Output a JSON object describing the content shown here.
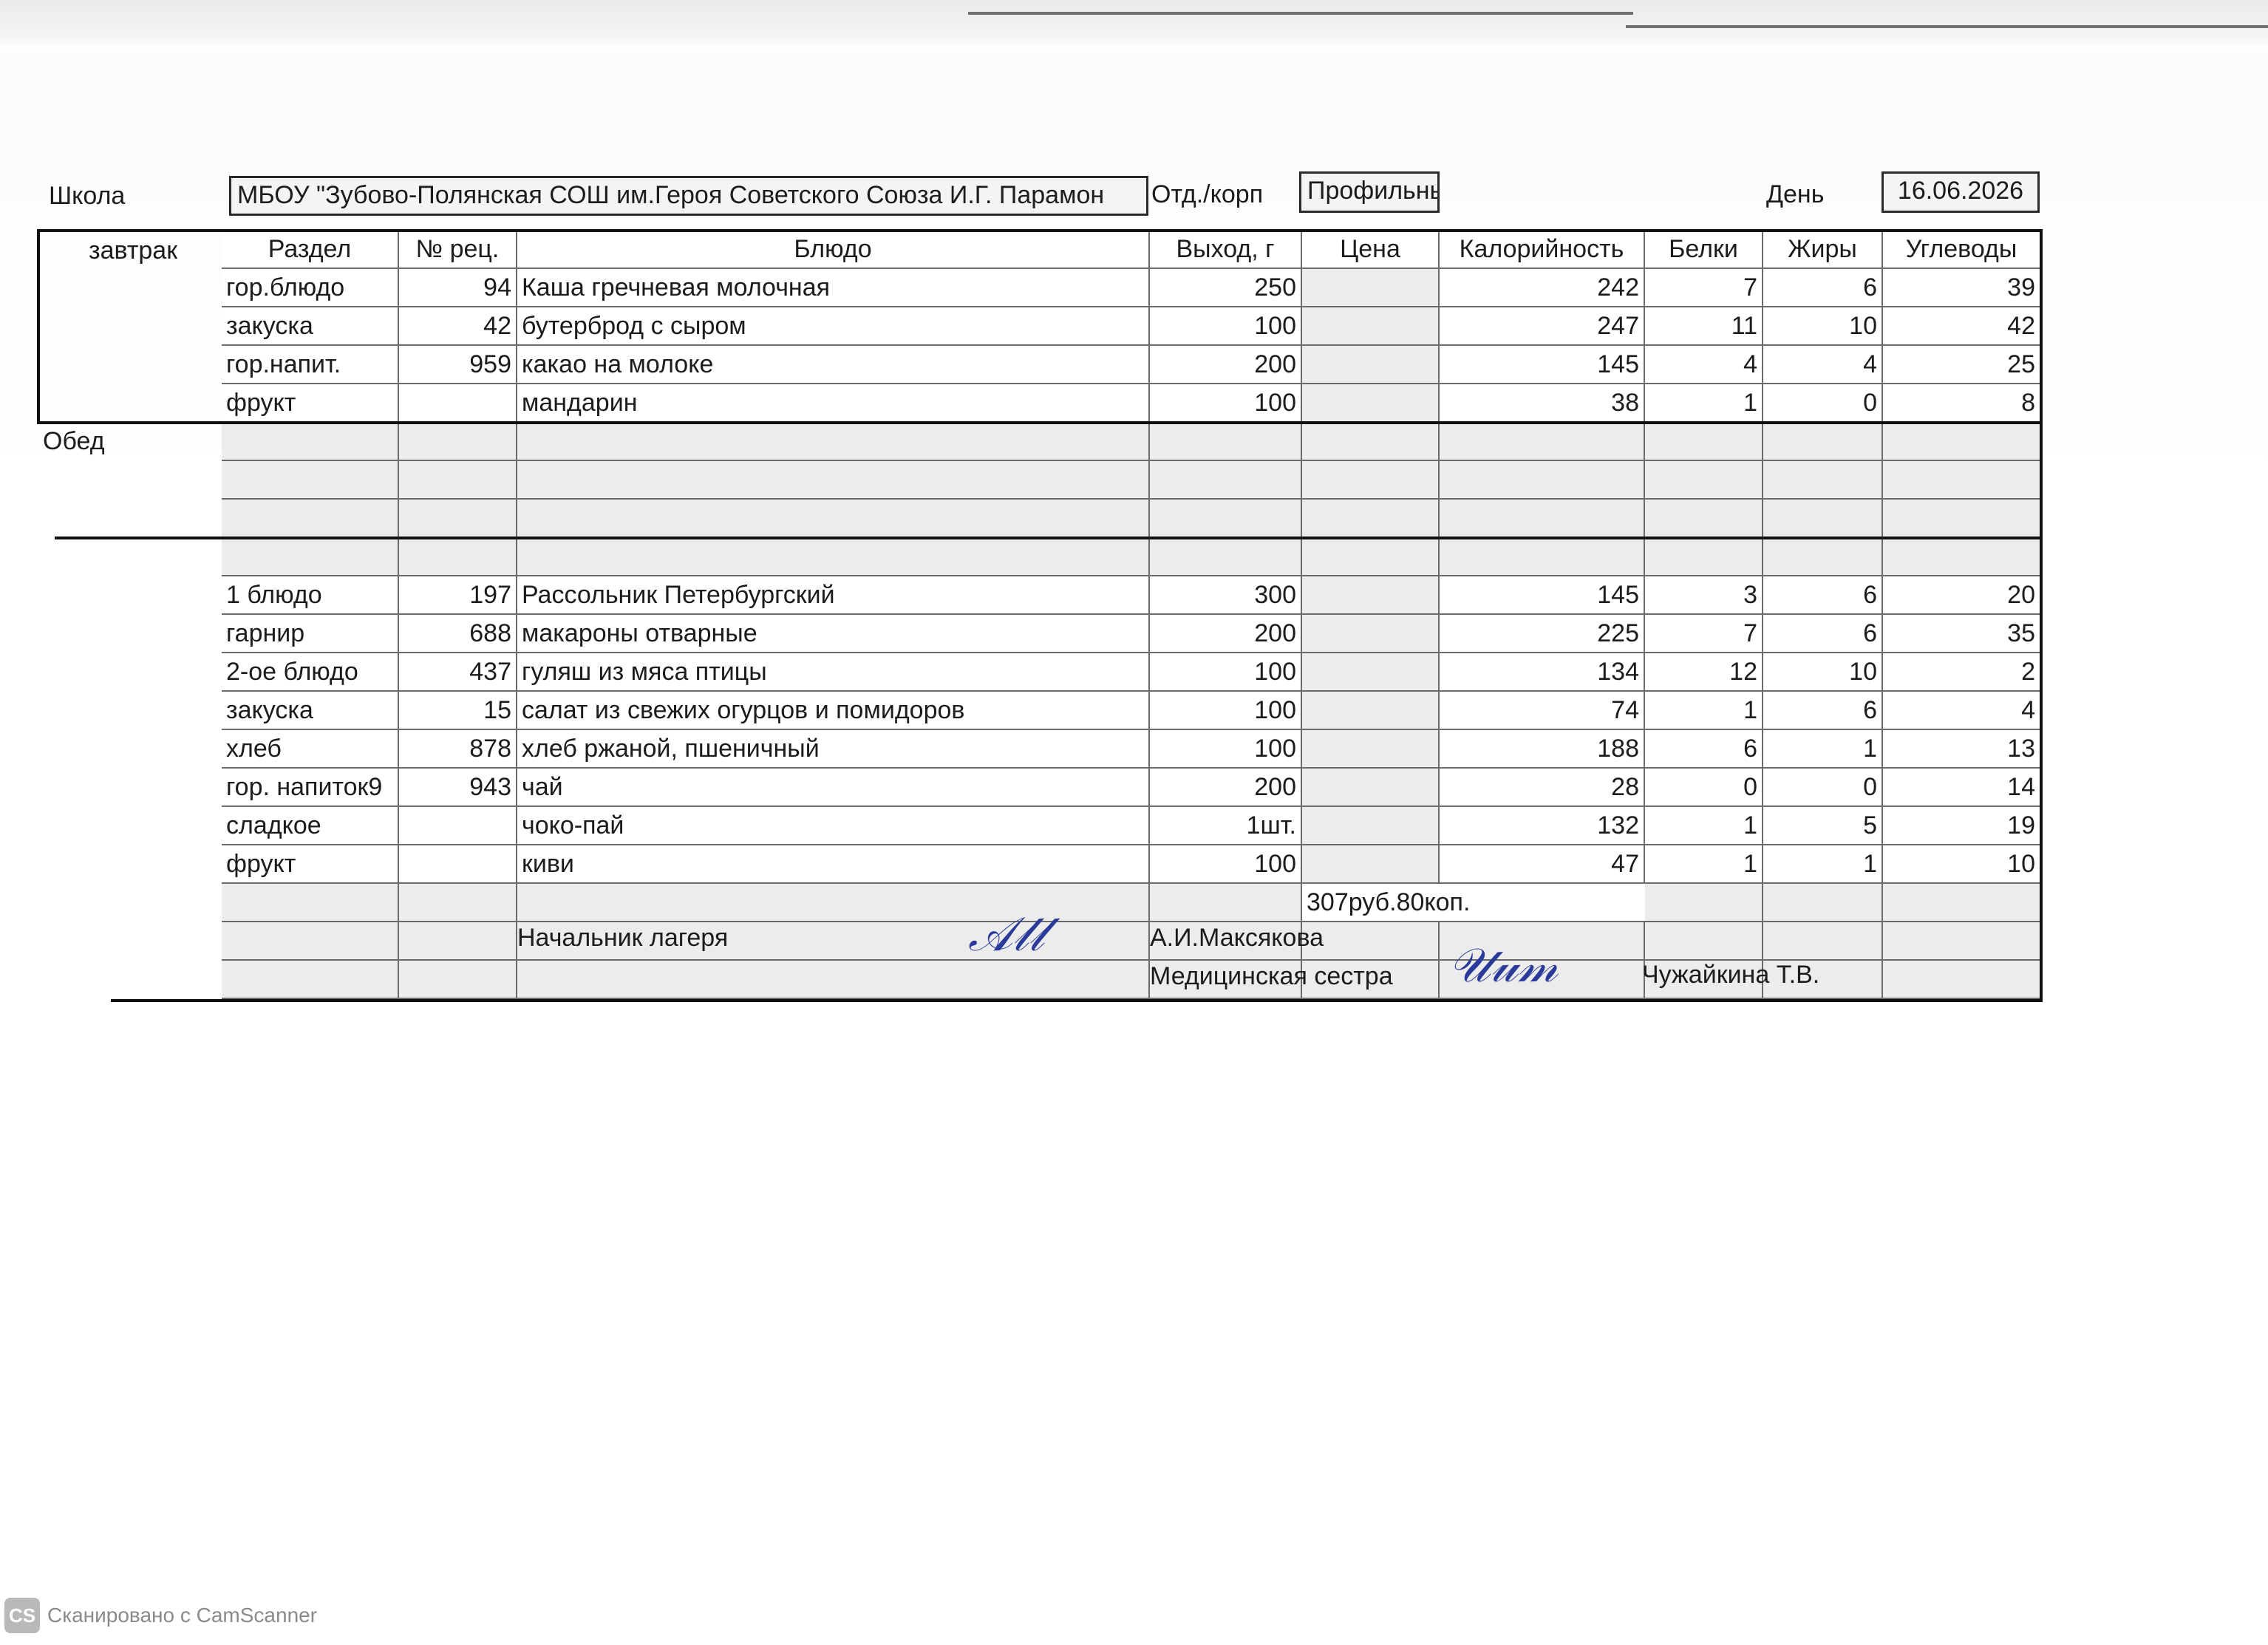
{
  "header": {
    "school_label": "Школа",
    "school_name": "МБОУ \"Зубово-Полянская СОШ им.Героя Советского Союза И.Г. Парамон",
    "dept_label": "Отд./корп",
    "dept_value": "Профильный",
    "day_label": "День",
    "day_value": "16.06.2026"
  },
  "columns": [
    "Раздел",
    "№ рец.",
    "Блюдо",
    "Выход, г",
    "Цена",
    "Калорийность",
    "Белки",
    "Жиры",
    "Углеводы"
  ],
  "breakfast": {
    "label": "завтрак",
    "rows": [
      [
        "гор.блюдо",
        "94",
        "Каша гречневая молочная",
        "250",
        "",
        "242",
        "7",
        "6",
        "39"
      ],
      [
        "закуска",
        "42",
        "бутерброд с сыром",
        "100",
        "",
        "247",
        "11",
        "10",
        "42"
      ],
      [
        "гор.напит.",
        "959",
        "какао на молоке",
        "200",
        "",
        "145",
        "4",
        "4",
        "25"
      ],
      [
        "фрукт",
        "",
        "мандарин",
        "100",
        "",
        "38",
        "1",
        "0",
        "8"
      ]
    ]
  },
  "lunch": {
    "label": "Обед",
    "rows": [
      [
        "1 блюдо",
        "197",
        "Рассольник Петербургский",
        "300",
        "",
        "145",
        "3",
        "6",
        "20"
      ],
      [
        "гарнир",
        "688",
        "макароны отварные",
        "200",
        "",
        "225",
        "7",
        "6",
        "35"
      ],
      [
        "2-ое блюдо",
        "437",
        "гуляш из мяса птицы",
        "100",
        "",
        "134",
        "12",
        "10",
        "2"
      ],
      [
        "закуска",
        "15",
        "салат из свежих огурцов и помидоров",
        "100",
        "",
        "74",
        "1",
        "6",
        "4"
      ],
      [
        "хлеб",
        "878",
        "хлеб ржаной, пшеничный",
        "100",
        "",
        "188",
        "6",
        "1",
        "13"
      ],
      [
        "гор. напиток9",
        "943",
        "чай",
        "200",
        "",
        "28",
        "0",
        "0",
        "14"
      ],
      [
        "сладкое",
        "",
        "чоко-пай",
        "1шт.",
        "",
        "132",
        "1",
        "5",
        "19"
      ],
      [
        "фрукт",
        "",
        "киви",
        "100",
        "",
        "47",
        "1",
        "1",
        "10"
      ]
    ],
    "total_price": "307руб.80коп."
  },
  "signatures": {
    "head_label": "Начальник лагеря",
    "head_name": "А.И.Максякова",
    "nurse_label": "Медицинская сестра",
    "nurse_name": "Чужайкина Т.В."
  },
  "watermark": {
    "badge": "CS",
    "text": "Сканировано с CamScanner"
  }
}
